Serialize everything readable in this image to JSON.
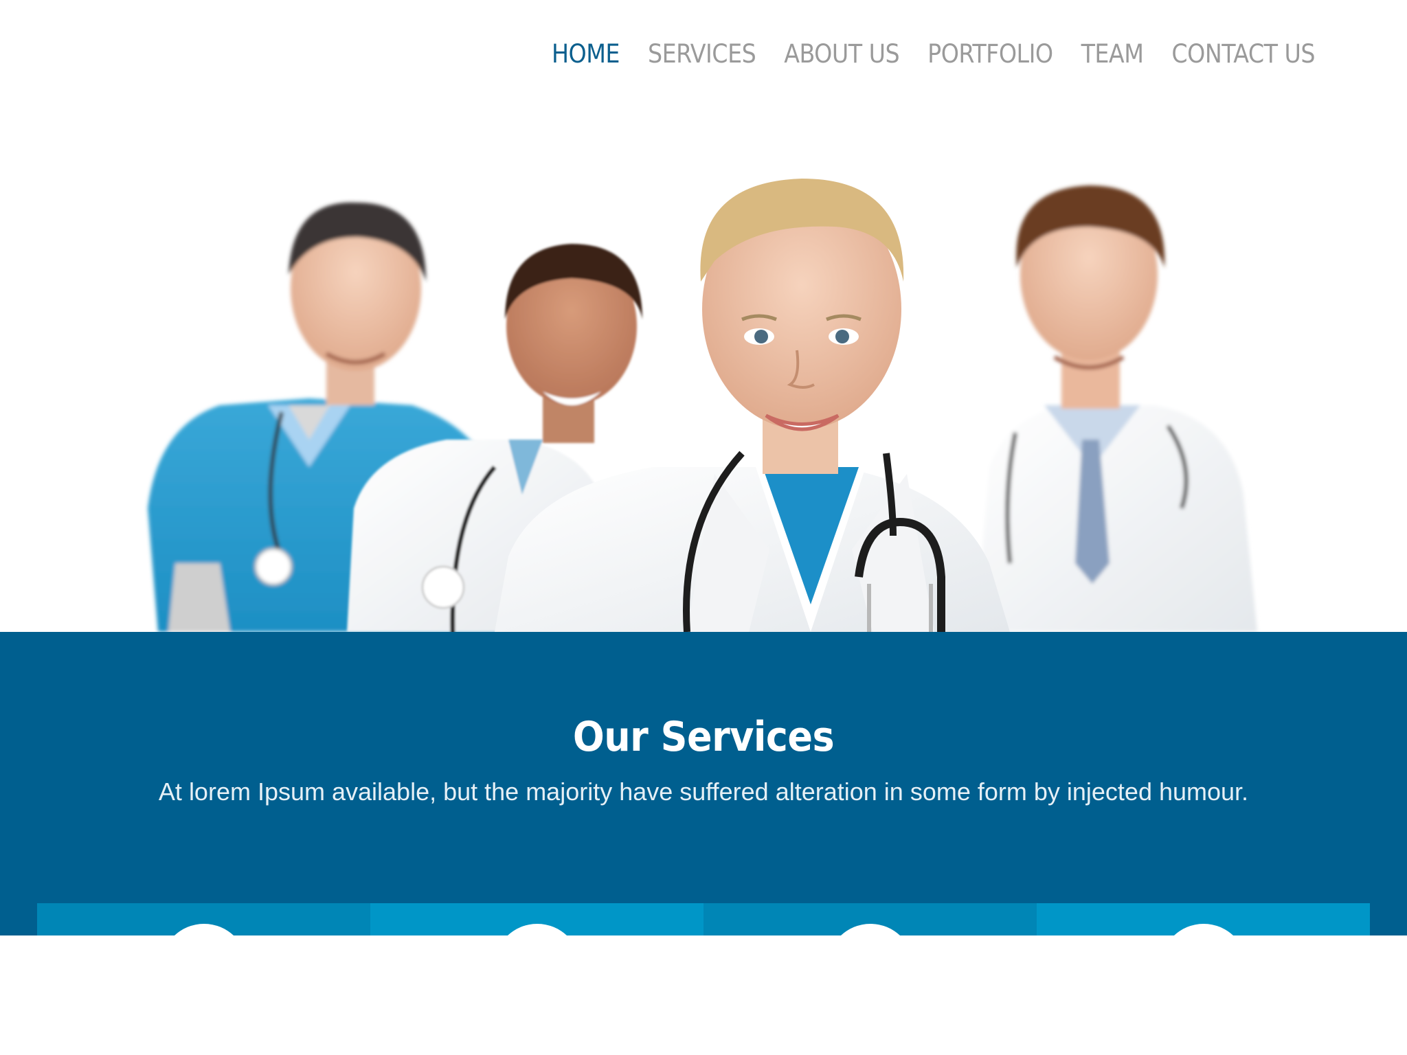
{
  "nav": {
    "items": [
      {
        "label": "HOME",
        "active": true
      },
      {
        "label": "SERVICES",
        "active": false
      },
      {
        "label": "ABOUT US",
        "active": false
      },
      {
        "label": "PORTFOLIO",
        "active": false
      },
      {
        "label": "TEAM",
        "active": false
      },
      {
        "label": "CONTACT US",
        "active": false
      }
    ]
  },
  "services": {
    "title": "Our Services",
    "subtitle": "At lorem Ipsum available, but the majority have suffered alteration in some form by injected humour.",
    "tiles": [
      {
        "color": "#0086b6"
      },
      {
        "color": "#0096c7"
      },
      {
        "color": "#0086b6"
      },
      {
        "color": "#0096c7"
      }
    ]
  },
  "colors": {
    "primary": "#005f8f",
    "nav_active": "#0b5f8e",
    "nav_inactive": "#9a9a9a",
    "tile_dark": "#0086b6",
    "tile_light": "#0096c7"
  }
}
